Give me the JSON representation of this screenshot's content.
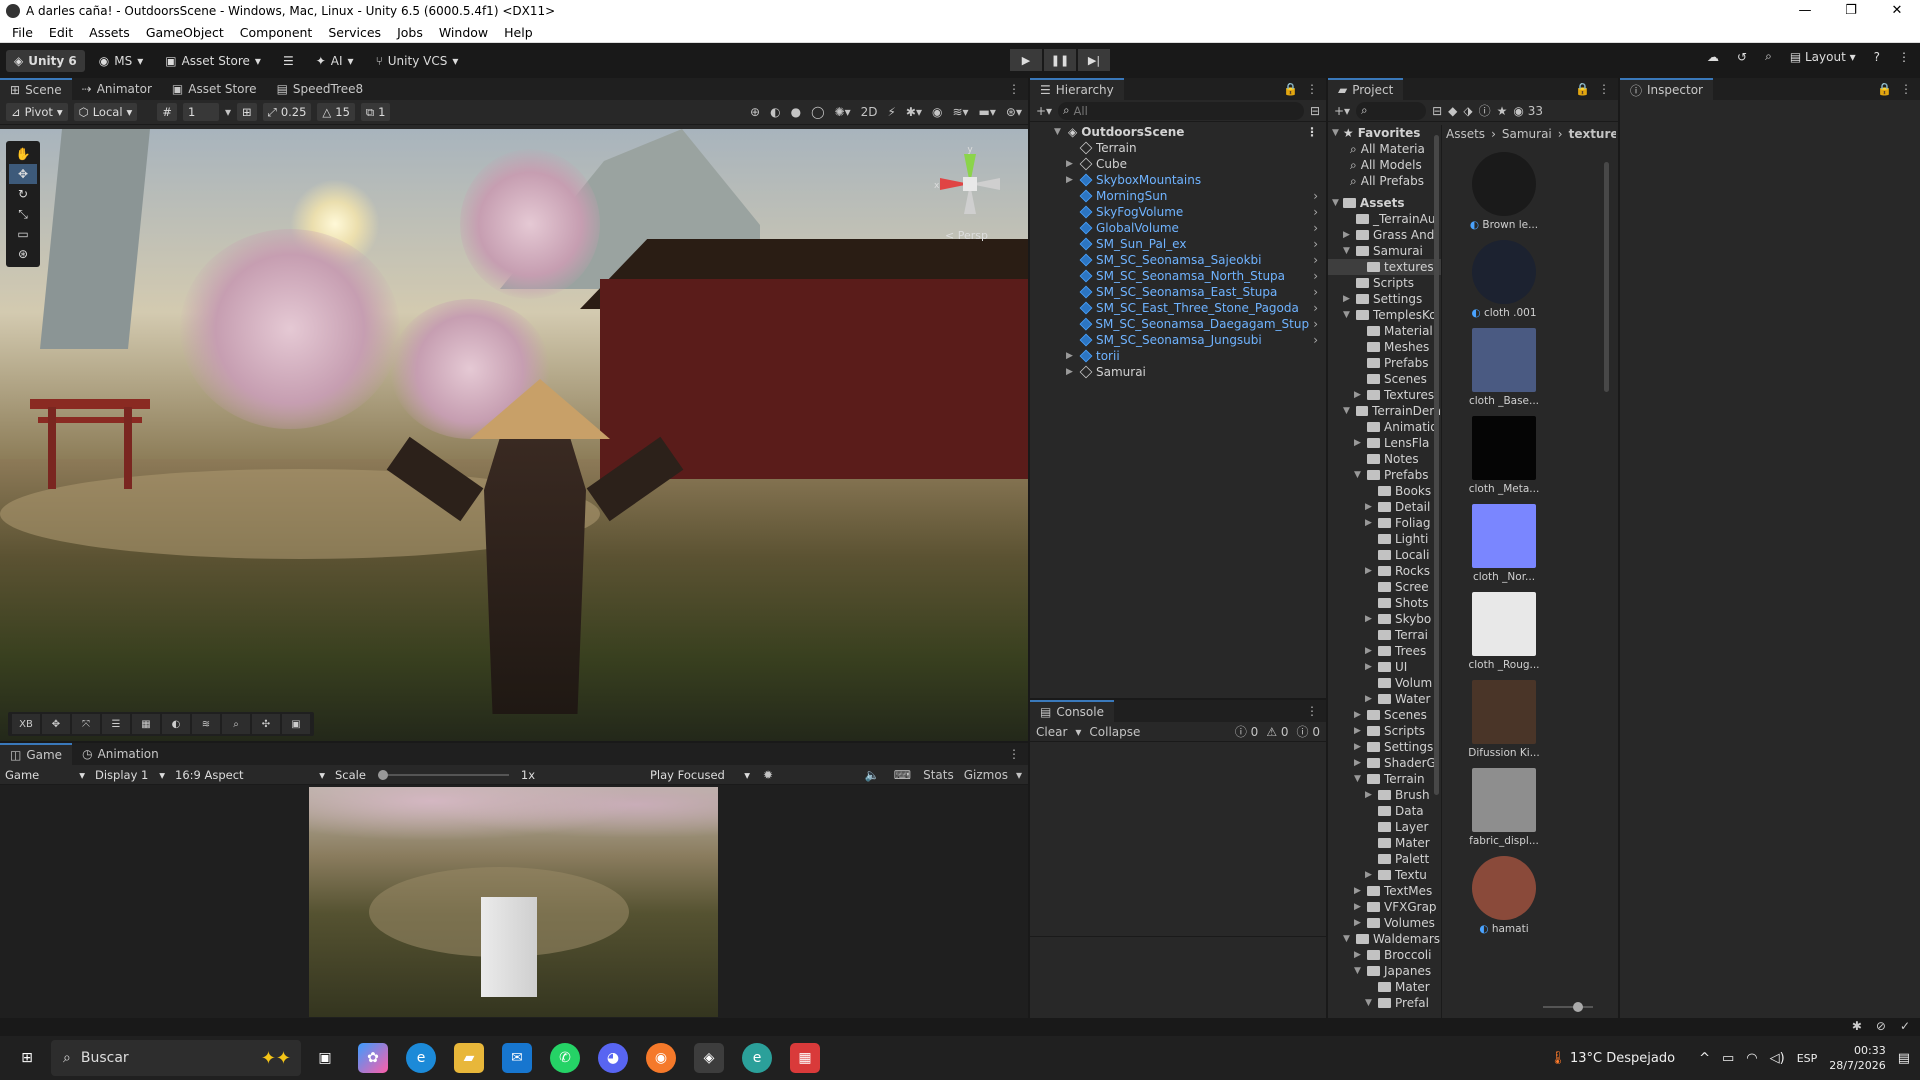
{
  "window": {
    "title": "A darles caña! - OutdoorsScene - Windows, Mac, Linux - Unity 6.5 (6000.5.4f1) <DX11>",
    "minimize": "—",
    "maximize": "❐",
    "close": "✕"
  },
  "menu": [
    "File",
    "Edit",
    "Assets",
    "GameObject",
    "Component",
    "Services",
    "Jobs",
    "Window",
    "Help"
  ],
  "toolbar": {
    "unity": "Unity 6",
    "account": "MS",
    "asset_store": "Asset Store",
    "ai": "AI",
    "vcs": "Unity VCS",
    "layout": "Layout"
  },
  "scene_tabs": [
    "Scene",
    "Animator",
    "Asset Store",
    "SpeedTree8"
  ],
  "scene_toolbar": {
    "pivot": "Pivot",
    "local": "Local",
    "grid": "1",
    "snap": "0.25",
    "rot": "15",
    "scale": "1"
  },
  "scene_view": {
    "persp": "< Persp",
    "gizmo_y": "y",
    "gizmo_x": "x",
    "overlay_xb": "XB"
  },
  "game_tabs": [
    "Game",
    "Animation"
  ],
  "game_toolbar": {
    "mode": "Game",
    "display": "Display 1",
    "aspect": "16:9 Aspect",
    "scale_label": "Scale",
    "scale_value": "1x",
    "play_focused": "Play Focused",
    "stats": "Stats",
    "gizmos": "Gizmos"
  },
  "hierarchy": {
    "tab": "Hierarchy",
    "search_placeholder": "All",
    "root": "OutdoorsScene",
    "items": [
      {
        "name": "Terrain",
        "blue": false,
        "arrow": ""
      },
      {
        "name": "Cube",
        "blue": false,
        "arrow": "▶"
      },
      {
        "name": "SkyboxMountains",
        "blue": true,
        "arrow": "▶"
      },
      {
        "name": "MorningSun",
        "blue": true,
        "arrow": ""
      },
      {
        "name": "SkyFogVolume",
        "blue": true,
        "arrow": ""
      },
      {
        "name": "GlobalVolume",
        "blue": true,
        "arrow": ""
      },
      {
        "name": "SM_Sun_Pal_ex",
        "blue": true,
        "arrow": ""
      },
      {
        "name": "SM_SC_Seonamsa_Sajeokbi",
        "blue": true,
        "arrow": ""
      },
      {
        "name": "SM_SC_Seonamsa_North_Stupa",
        "blue": true,
        "arrow": ""
      },
      {
        "name": "SM_SC_Seonamsa_East_Stupa",
        "blue": true,
        "arrow": ""
      },
      {
        "name": "SM_SC_East_Three_Stone_Pagoda",
        "blue": true,
        "arrow": ""
      },
      {
        "name": "SM_SC_Seonamsa_Daegagam_Stupa",
        "blue": true,
        "arrow": ""
      },
      {
        "name": "SM_SC_Seonamsa_Jungsubi",
        "blue": true,
        "arrow": ""
      },
      {
        "name": "torii",
        "blue": true,
        "arrow": "▶"
      },
      {
        "name": "Samurai",
        "blue": false,
        "arrow": "▶"
      }
    ]
  },
  "console": {
    "tab": "Console",
    "clear": "Clear",
    "collapse": "Collapse",
    "info_count": "0",
    "warn_count": "0",
    "error_count": "0"
  },
  "project": {
    "tab": "Project",
    "hidden_count": "33",
    "breadcrumb": [
      "Assets",
      "Samurai",
      "textures"
    ],
    "favorites_label": "Favorites",
    "favorites": [
      "All Materia",
      "All Models",
      "All Prefabs"
    ],
    "assets_label": "Assets",
    "tree": [
      {
        "name": "_TerrainAu",
        "depth": 1,
        "arrow": ""
      },
      {
        "name": "Grass And",
        "depth": 1,
        "arrow": "▶"
      },
      {
        "name": "Samurai",
        "depth": 1,
        "arrow": "▼"
      },
      {
        "name": "textures",
        "depth": 2,
        "arrow": "",
        "selected": true
      },
      {
        "name": "Scripts",
        "depth": 1,
        "arrow": ""
      },
      {
        "name": "Settings",
        "depth": 1,
        "arrow": "▶"
      },
      {
        "name": "TemplesKo",
        "depth": 1,
        "arrow": "▼"
      },
      {
        "name": "Material",
        "depth": 2,
        "arrow": ""
      },
      {
        "name": "Meshes",
        "depth": 2,
        "arrow": ""
      },
      {
        "name": "Prefabs",
        "depth": 2,
        "arrow": ""
      },
      {
        "name": "Scenes",
        "depth": 2,
        "arrow": ""
      },
      {
        "name": "Textures",
        "depth": 2,
        "arrow": "▶"
      },
      {
        "name": "TerrainDem",
        "depth": 1,
        "arrow": "▼"
      },
      {
        "name": "Animatio",
        "depth": 2,
        "arrow": ""
      },
      {
        "name": "LensFla",
        "depth": 2,
        "arrow": "▶"
      },
      {
        "name": "Notes",
        "depth": 2,
        "arrow": ""
      },
      {
        "name": "Prefabs",
        "depth": 2,
        "arrow": "▼"
      },
      {
        "name": "Books",
        "depth": 3,
        "arrow": ""
      },
      {
        "name": "Detail",
        "depth": 3,
        "arrow": "▶"
      },
      {
        "name": "Foliag",
        "depth": 3,
        "arrow": "▶"
      },
      {
        "name": "Lighti",
        "depth": 3,
        "arrow": ""
      },
      {
        "name": "Locali",
        "depth": 3,
        "arrow": ""
      },
      {
        "name": "Rocks",
        "depth": 3,
        "arrow": "▶"
      },
      {
        "name": "Scree",
        "depth": 3,
        "arrow": ""
      },
      {
        "name": "Shots",
        "depth": 3,
        "arrow": ""
      },
      {
        "name": "Skybo",
        "depth": 3,
        "arrow": "▶"
      },
      {
        "name": "Terrai",
        "depth": 3,
        "arrow": ""
      },
      {
        "name": "Trees",
        "depth": 3,
        "arrow": "▶"
      },
      {
        "name": "UI",
        "depth": 3,
        "arrow": "▶"
      },
      {
        "name": "Volum",
        "depth": 3,
        "arrow": ""
      },
      {
        "name": "Water",
        "depth": 3,
        "arrow": "▶"
      },
      {
        "name": "Scenes",
        "depth": 2,
        "arrow": "▶"
      },
      {
        "name": "Scripts",
        "depth": 2,
        "arrow": "▶"
      },
      {
        "name": "Settings",
        "depth": 2,
        "arrow": "▶"
      },
      {
        "name": "ShaderG",
        "depth": 2,
        "arrow": "▶"
      },
      {
        "name": "Terrain",
        "depth": 2,
        "arrow": "▼"
      },
      {
        "name": "Brush",
        "depth": 3,
        "arrow": "▶"
      },
      {
        "name": "Data",
        "depth": 3,
        "arrow": ""
      },
      {
        "name": "Layer",
        "depth": 3,
        "arrow": ""
      },
      {
        "name": "Mater",
        "depth": 3,
        "arrow": ""
      },
      {
        "name": "Palett",
        "depth": 3,
        "arrow": ""
      },
      {
        "name": "Textu",
        "depth": 3,
        "arrow": "▶"
      },
      {
        "name": "TextMes",
        "depth": 2,
        "arrow": "▶"
      },
      {
        "name": "VFXGrap",
        "depth": 2,
        "arrow": "▶"
      },
      {
        "name": "Volumes",
        "depth": 2,
        "arrow": "▶"
      },
      {
        "name": "Waldemars",
        "depth": 1,
        "arrow": "▼"
      },
      {
        "name": "Broccoli",
        "depth": 2,
        "arrow": "▶"
      },
      {
        "name": "Japanes",
        "depth": 2,
        "arrow": "▼"
      },
      {
        "name": "Mater",
        "depth": 3,
        "arrow": ""
      },
      {
        "name": "Prefal",
        "depth": 3,
        "arrow": "▼"
      }
    ],
    "assets": [
      {
        "label": "Brown le...",
        "color": "#1a1a1a",
        "badge": true
      },
      {
        "label": "cloth .001",
        "color": "#1c2230",
        "badge": true
      },
      {
        "label": "cloth _Base...",
        "color": "#4a5a82",
        "badge": false
      },
      {
        "label": "cloth _Meta...",
        "color": "#050505",
        "badge": false
      },
      {
        "label": "cloth _Nor...",
        "color": "#7a86ff",
        "badge": false
      },
      {
        "label": "cloth _Roug...",
        "color": "#e8e8e8",
        "badge": false
      },
      {
        "label": "Difussion Ki...",
        "color": "#4a3528",
        "badge": false
      },
      {
        "label": "fabric_displ...",
        "color": "#8e8e8e",
        "badge": false
      },
      {
        "label": "hamati",
        "color": "#8a4a3a",
        "badge": true
      }
    ]
  },
  "inspector": {
    "tab": "Inspector"
  },
  "taskbar": {
    "search": "Buscar",
    "weather": "13°C  Despejado",
    "lang": "ESP",
    "time": "00:33",
    "date": "28/7/2026"
  }
}
